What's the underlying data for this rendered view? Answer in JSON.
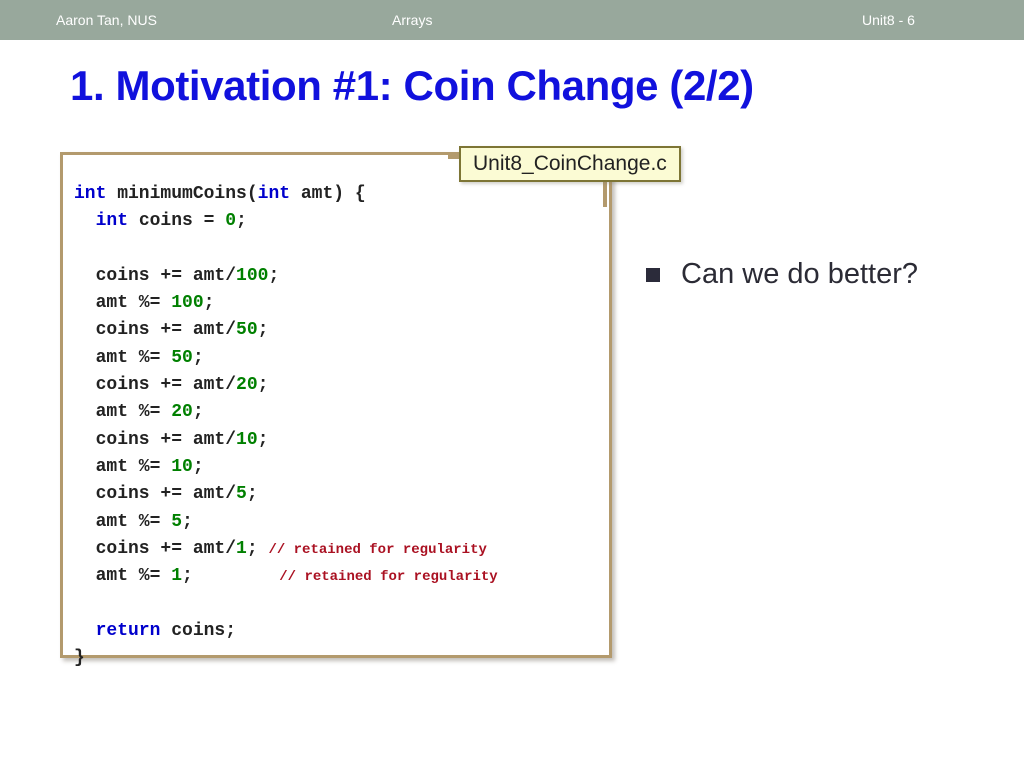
{
  "header": {
    "author": "Aaron Tan, NUS",
    "topic": "Arrays",
    "unit": "Unit8 - 6",
    "background_color": "#98a89c",
    "text_color": "#ffffff"
  },
  "slide": {
    "title": "1. Motivation #1: Coin Change (2/2)",
    "title_color": "#1111dd"
  },
  "code_panel": {
    "border_color": "#b39a6d",
    "keyword_color": "#0000cc",
    "number_color": "#008000",
    "comment_color": "#aa1122",
    "plain_color": "#222222",
    "lines": [
      [
        {
          "t": "int",
          "c": "kw"
        },
        {
          "t": " minimumCoins(",
          "c": "pln"
        },
        {
          "t": "int",
          "c": "kw"
        },
        {
          "t": " amt) {",
          "c": "pln"
        }
      ],
      [
        {
          "t": "  ",
          "c": "pln"
        },
        {
          "t": "int",
          "c": "kw"
        },
        {
          "t": " coins = ",
          "c": "pln"
        },
        {
          "t": "0",
          "c": "num"
        },
        {
          "t": ";",
          "c": "pln"
        }
      ],
      [],
      [
        {
          "t": "  coins += amt/",
          "c": "pln"
        },
        {
          "t": "100",
          "c": "num"
        },
        {
          "t": ";",
          "c": "pln"
        }
      ],
      [
        {
          "t": "  amt %= ",
          "c": "pln"
        },
        {
          "t": "100",
          "c": "num"
        },
        {
          "t": ";",
          "c": "pln"
        }
      ],
      [
        {
          "t": "  coins += amt/",
          "c": "pln"
        },
        {
          "t": "50",
          "c": "num"
        },
        {
          "t": ";",
          "c": "pln"
        }
      ],
      [
        {
          "t": "  amt %= ",
          "c": "pln"
        },
        {
          "t": "50",
          "c": "num"
        },
        {
          "t": ";",
          "c": "pln"
        }
      ],
      [
        {
          "t": "  coins += amt/",
          "c": "pln"
        },
        {
          "t": "20",
          "c": "num"
        },
        {
          "t": ";",
          "c": "pln"
        }
      ],
      [
        {
          "t": "  amt %= ",
          "c": "pln"
        },
        {
          "t": "20",
          "c": "num"
        },
        {
          "t": ";",
          "c": "pln"
        }
      ],
      [
        {
          "t": "  coins += amt/",
          "c": "pln"
        },
        {
          "t": "10",
          "c": "num"
        },
        {
          "t": ";",
          "c": "pln"
        }
      ],
      [
        {
          "t": "  amt %= ",
          "c": "pln"
        },
        {
          "t": "10",
          "c": "num"
        },
        {
          "t": ";",
          "c": "pln"
        }
      ],
      [
        {
          "t": "  coins += amt/",
          "c": "pln"
        },
        {
          "t": "5",
          "c": "num"
        },
        {
          "t": ";",
          "c": "pln"
        }
      ],
      [
        {
          "t": "  amt %= ",
          "c": "pln"
        },
        {
          "t": "5",
          "c": "num"
        },
        {
          "t": ";",
          "c": "pln"
        }
      ],
      [
        {
          "t": "  coins += amt/",
          "c": "pln"
        },
        {
          "t": "1",
          "c": "num"
        },
        {
          "t": "; ",
          "c": "pln"
        },
        {
          "t": "// retained for regularity",
          "c": "cmt"
        }
      ],
      [
        {
          "t": "  amt %= ",
          "c": "pln"
        },
        {
          "t": "1",
          "c": "num"
        },
        {
          "t": ";        ",
          "c": "pln"
        },
        {
          "t": "// retained for regularity",
          "c": "cmt"
        }
      ],
      [],
      [
        {
          "t": "  ",
          "c": "pln"
        },
        {
          "t": "return",
          "c": "kw"
        },
        {
          "t": " coins;",
          "c": "pln"
        }
      ],
      [
        {
          "t": "}",
          "c": "pln"
        }
      ]
    ]
  },
  "file_callout": {
    "label": "Unit8_CoinChange.c",
    "background_color": "#fbfbd4",
    "border_color": "#7d7535"
  },
  "bullets": [
    {
      "text": "Can we do better?",
      "marker_color": "#2b2b3a"
    }
  ]
}
